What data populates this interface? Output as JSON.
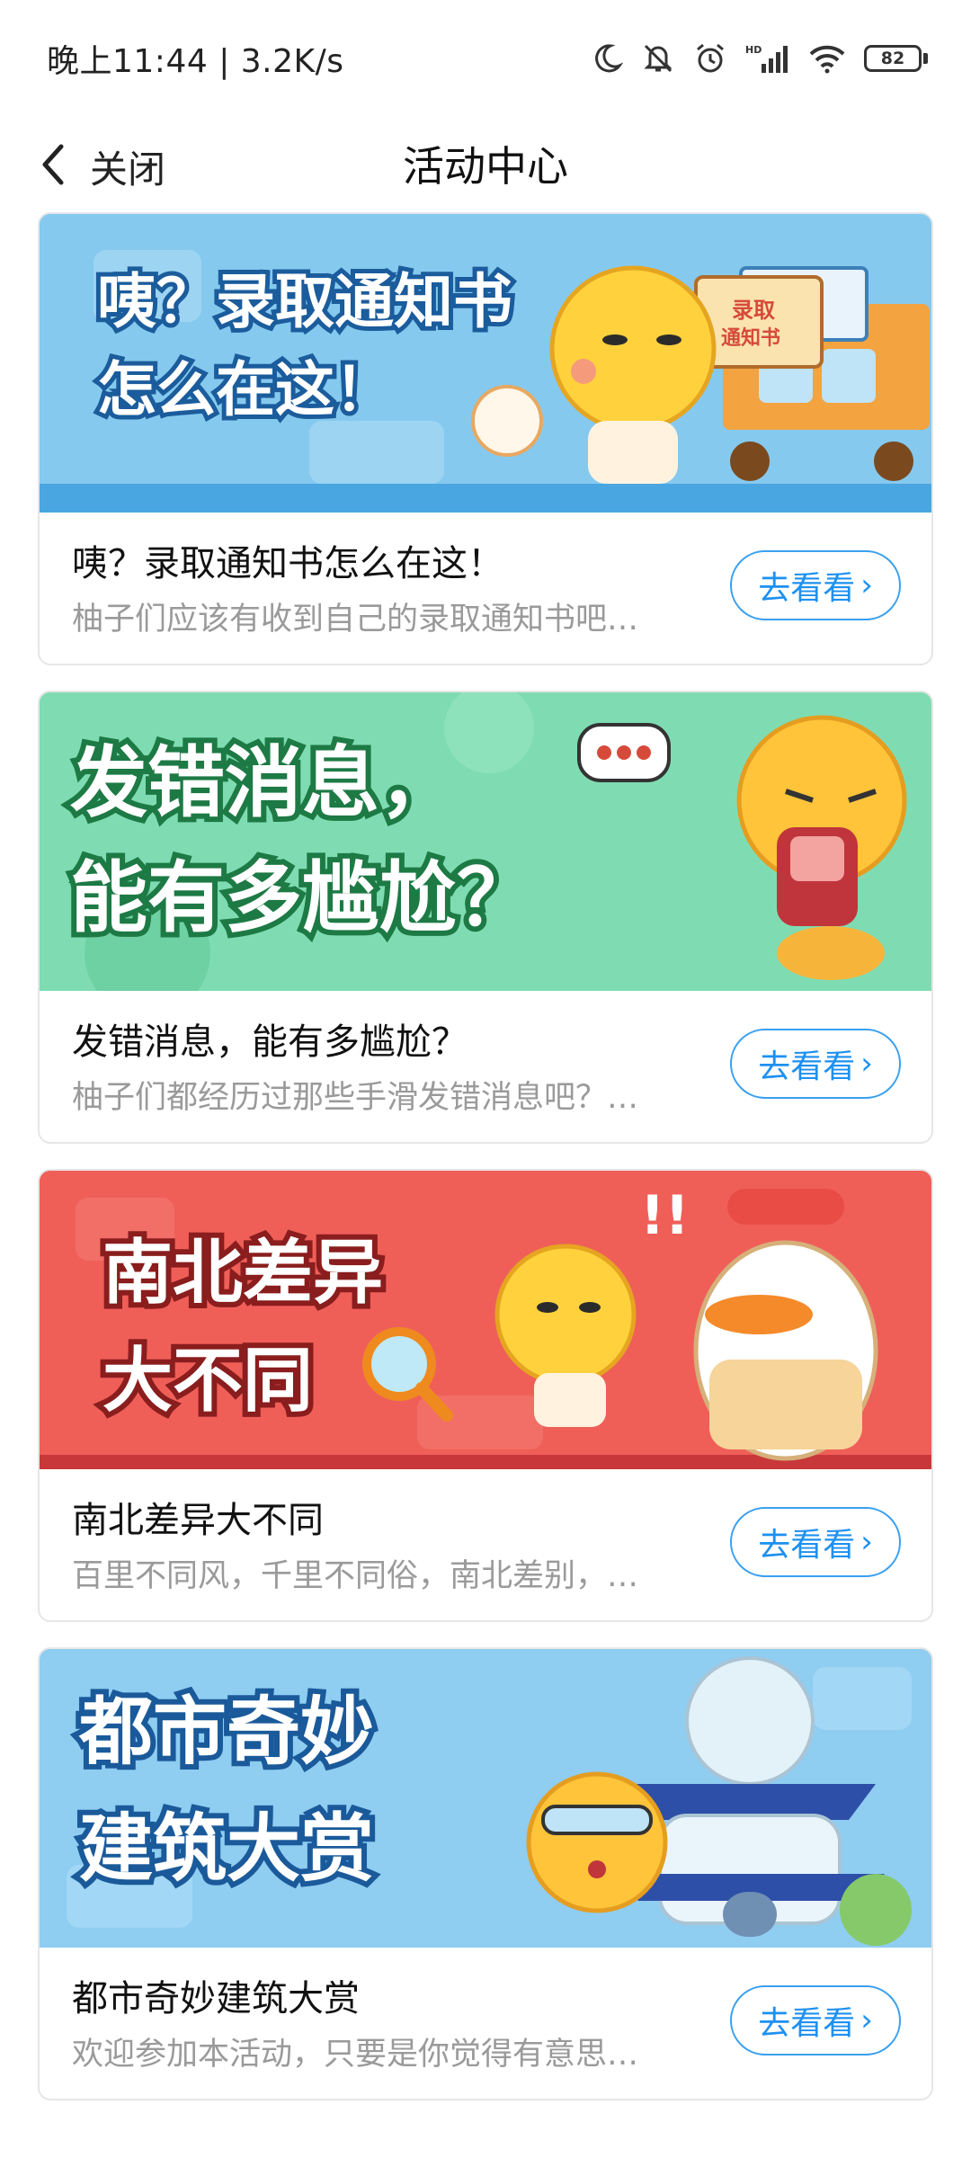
{
  "status_bar": {
    "time_speed": "晚上11:44 | 3.2K/s",
    "battery": "82"
  },
  "nav": {
    "back_label": "关闭",
    "title": "活动中心"
  },
  "cards": [
    {
      "banner_line1": "咦？录取通知书",
      "banner_line2": "怎么在这！",
      "banner_badge": "录取\n通知书",
      "banner_color": "#7cc4ec",
      "title": "咦？录取通知书怎么在这！",
      "desc": "柚子们应该有收到自己的录取通知书吧…",
      "button": "去看看"
    },
    {
      "banner_line1": "发错消息，",
      "banner_line2": "能有多尴尬？",
      "banner_color": "#6fd6a8",
      "title": "发错消息，能有多尴尬？",
      "desc": "柚子们都经历过那些手滑发错消息吧？…",
      "button": "去看看"
    },
    {
      "banner_line1": "南北差异",
      "banner_line2": "大不同",
      "banner_color": "#ee5a54",
      "title": "南北差异大不同",
      "desc": "百里不同风，千里不同俗，南北差别，…",
      "button": "去看看"
    },
    {
      "banner_line1": "都市奇妙",
      "banner_line2": "建筑大赏",
      "banner_color": "#8ccaf0",
      "title": "都市奇妙建筑大赏",
      "desc": "欢迎参加本活动，只要是你觉得有意思…",
      "button": "去看看"
    }
  ]
}
